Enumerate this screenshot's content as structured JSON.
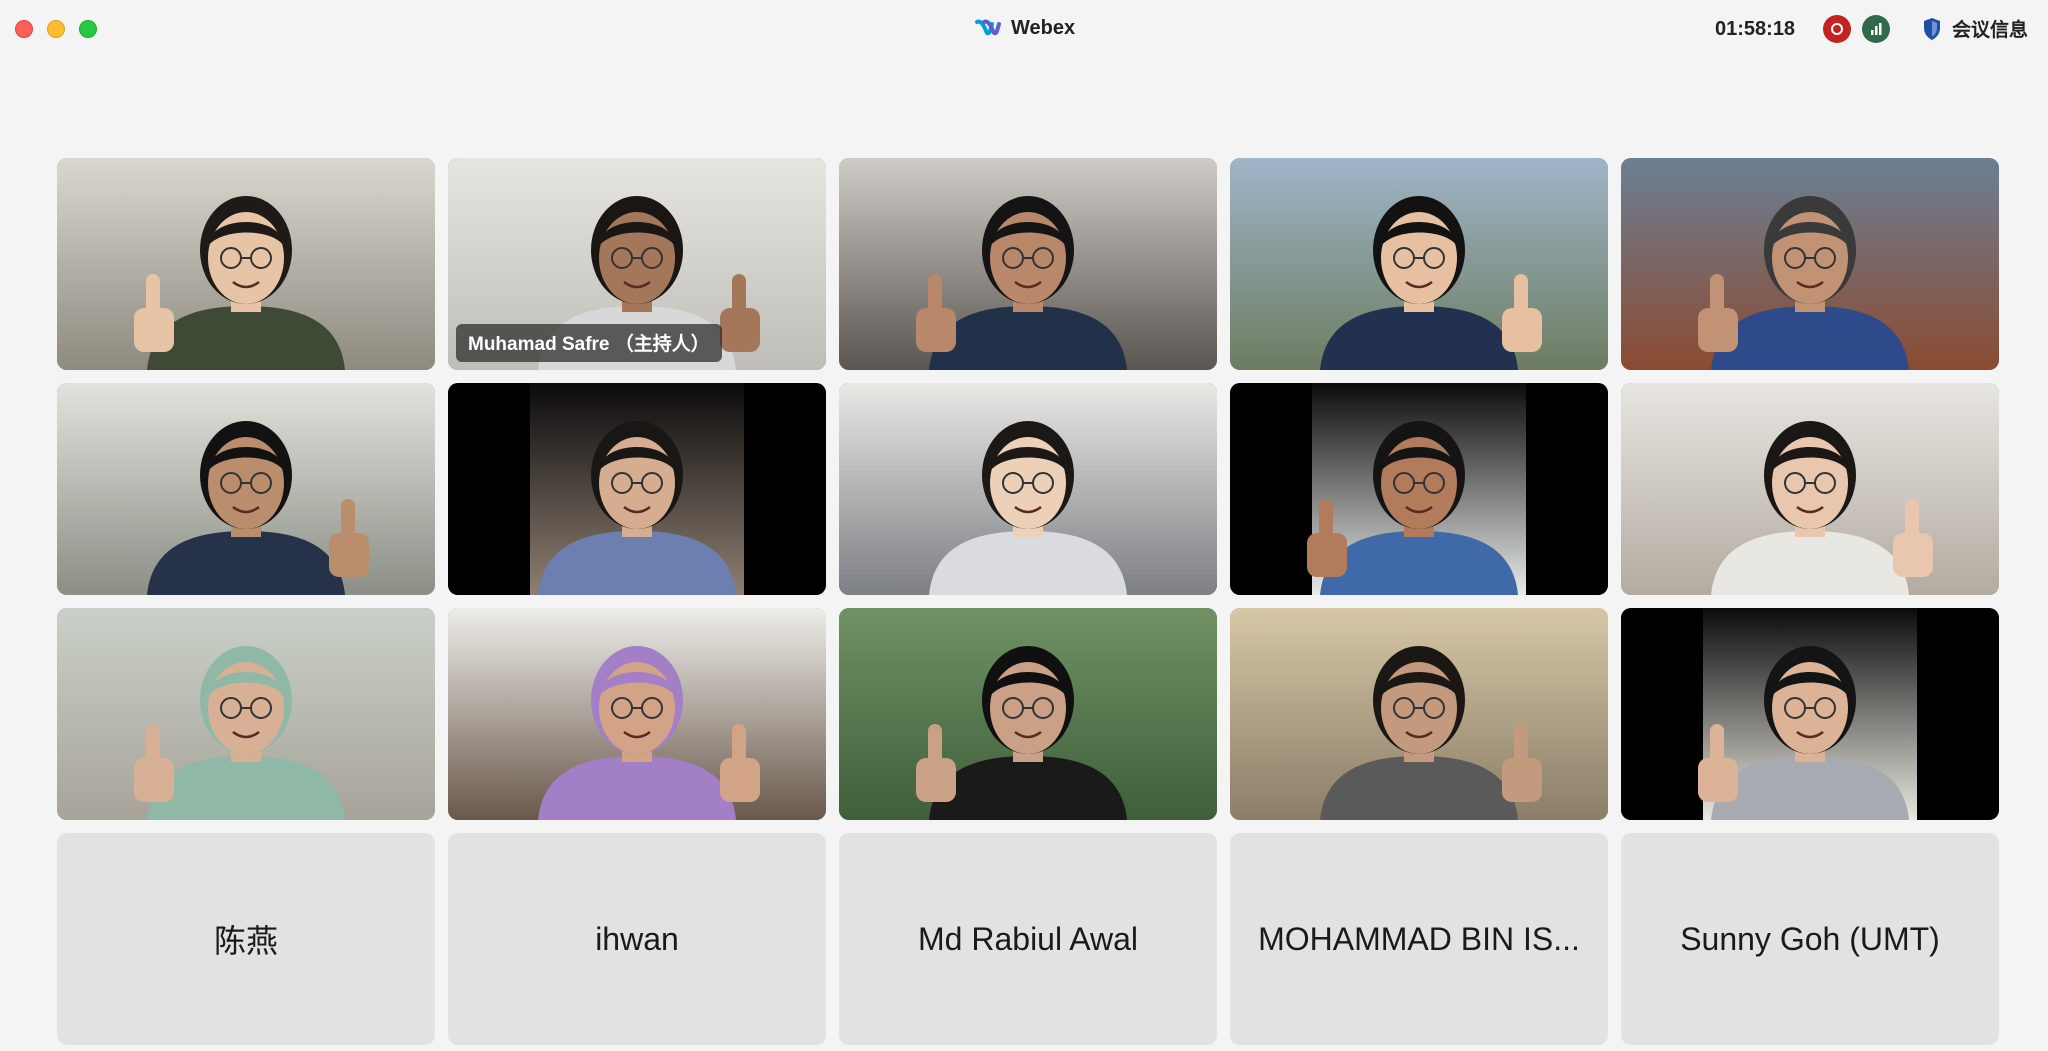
{
  "app": {
    "title": "Webex",
    "timer": "01:58:18",
    "meeting_info_label": "会议信息",
    "colors": {
      "record": "#c4231f",
      "signal": "#2f6b48",
      "active_speaker_border": "#3da5f0"
    }
  },
  "video_tiles": [
    {
      "name": "",
      "bg": [
        "#d9d7cf",
        "#8e8a80"
      ],
      "skin": "#e7c4a6",
      "shirt": "#3f4a36",
      "hair": "#1f1a17",
      "thumb": true,
      "active": false,
      "label": ""
    },
    {
      "name": "Muhamad Safre （主持人）",
      "bg": [
        "#e7e5e0",
        "#bfbdb7"
      ],
      "skin": "#a5775a",
      "shirt": "#d8d8d8",
      "hair": "#1a1614",
      "thumb": true,
      "active": true,
      "label": "Muhamad Safre （主持人）"
    },
    {
      "name": "",
      "bg": [
        "#cfcbc6",
        "#5a5550"
      ],
      "skin": "#b9876a",
      "shirt": "#233049",
      "hair": "#141414",
      "thumb": true,
      "active": false,
      "label": ""
    },
    {
      "name": "",
      "bg": [
        "#9fb5c8",
        "#6d7d62"
      ],
      "skin": "#e6c0a0",
      "shirt": "#22314f",
      "hair": "#121212",
      "thumb": true,
      "active": false,
      "label": ""
    },
    {
      "name": "",
      "bg": [
        "#6c7f94",
        "#8b4b32"
      ],
      "skin": "#c29274",
      "shirt": "#2d4a8b",
      "hair": "#3a3a3a",
      "thumb": true,
      "active": false,
      "label": ""
    },
    {
      "name": "",
      "bg": [
        "#e3e2dd",
        "#8b8f86"
      ],
      "skin": "#ba8e6c",
      "shirt": "#26324a",
      "hair": "#121212",
      "thumb": true,
      "active": false,
      "label": ""
    },
    {
      "name": "",
      "bg": [
        "#0b0b0b",
        "#8f7f72"
      ],
      "skin": "#d6ad90",
      "shirt": "#6d7fb0",
      "hair": "#191715",
      "thumb": false,
      "active": false,
      "label": "",
      "pillar": true
    },
    {
      "name": "",
      "bg": [
        "#e9e8e4",
        "#7c7f84"
      ],
      "skin": "#ecd0b8",
      "shirt": "#d9dbe0",
      "hair": "#1b1816",
      "thumb": false,
      "active": false,
      "label": ""
    },
    {
      "name": "",
      "bg": [
        "#0b0b0b",
        "#e9eaea"
      ],
      "skin": "#b27b5c",
      "shirt": "#3f69a8",
      "hair": "#141414",
      "thumb": true,
      "active": false,
      "label": "",
      "pillar": true
    },
    {
      "name": "",
      "bg": [
        "#e7e5e1",
        "#b3aba1"
      ],
      "skin": "#e8c7ae",
      "shirt": "#e9e7e1",
      "hair": "#1b1714",
      "thumb": true,
      "active": false,
      "label": ""
    },
    {
      "name": "",
      "bg": [
        "#c9d1c8",
        "#a8a39a"
      ],
      "skin": "#d8b095",
      "shirt": "#8fb8a7",
      "hair": "#8fb8a7",
      "thumb": true,
      "active": false,
      "label": ""
    },
    {
      "name": "",
      "bg": [
        "#eeede9",
        "#69584b"
      ],
      "skin": "#d3a388",
      "shirt": "#a37fc7",
      "hair": "#a37fc7",
      "thumb": true,
      "active": false,
      "label": ""
    },
    {
      "name": "",
      "bg": [
        "#6f9264",
        "#3f5e3b"
      ],
      "skin": "#caa086",
      "shirt": "#1a1a1a",
      "hair": "#101010",
      "thumb": true,
      "active": false,
      "label": ""
    },
    {
      "name": "",
      "bg": [
        "#d6c7a6",
        "#8b7d68"
      ],
      "skin": "#c39a7d",
      "shirt": "#5a5a5a",
      "hair": "#1b1714",
      "thumb": true,
      "active": false,
      "label": ""
    },
    {
      "name": "",
      "bg": [
        "#0b0b0b",
        "#e9e7e0"
      ],
      "skin": "#dcb396",
      "shirt": "#a7aab0",
      "hair": "#141414",
      "thumb": true,
      "active": false,
      "label": "",
      "pillar": true
    }
  ],
  "placeholder_tiles": [
    {
      "name": "陈燕"
    },
    {
      "name": "ihwan"
    },
    {
      "name": "Md Rabiul Awal"
    },
    {
      "name": "MOHAMMAD BIN IS..."
    },
    {
      "name": "Sunny Goh (UMT)"
    }
  ]
}
